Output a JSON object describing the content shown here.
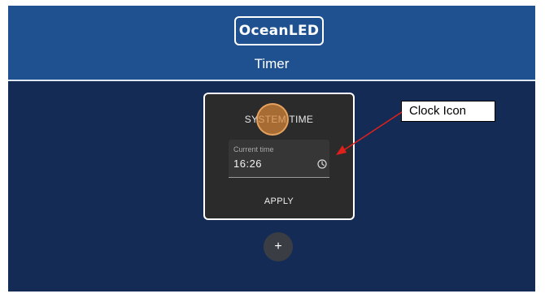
{
  "header": {
    "logo_text": "OceanLED",
    "title": "Timer"
  },
  "card": {
    "title": "SYSTEM TIME",
    "field": {
      "label": "Current time",
      "value": "16:26",
      "icon": "clock-icon"
    },
    "apply_label": "APPLY"
  },
  "add_button": {
    "label": "+"
  },
  "annotation": {
    "callout_text": "Clock Icon",
    "arrow_color": "#e0201b"
  },
  "colors": {
    "header_bg": "#1f5190",
    "page_bg": "#142c55",
    "card_bg": "#2b2b2b",
    "touch_indicator": "#d68538"
  }
}
